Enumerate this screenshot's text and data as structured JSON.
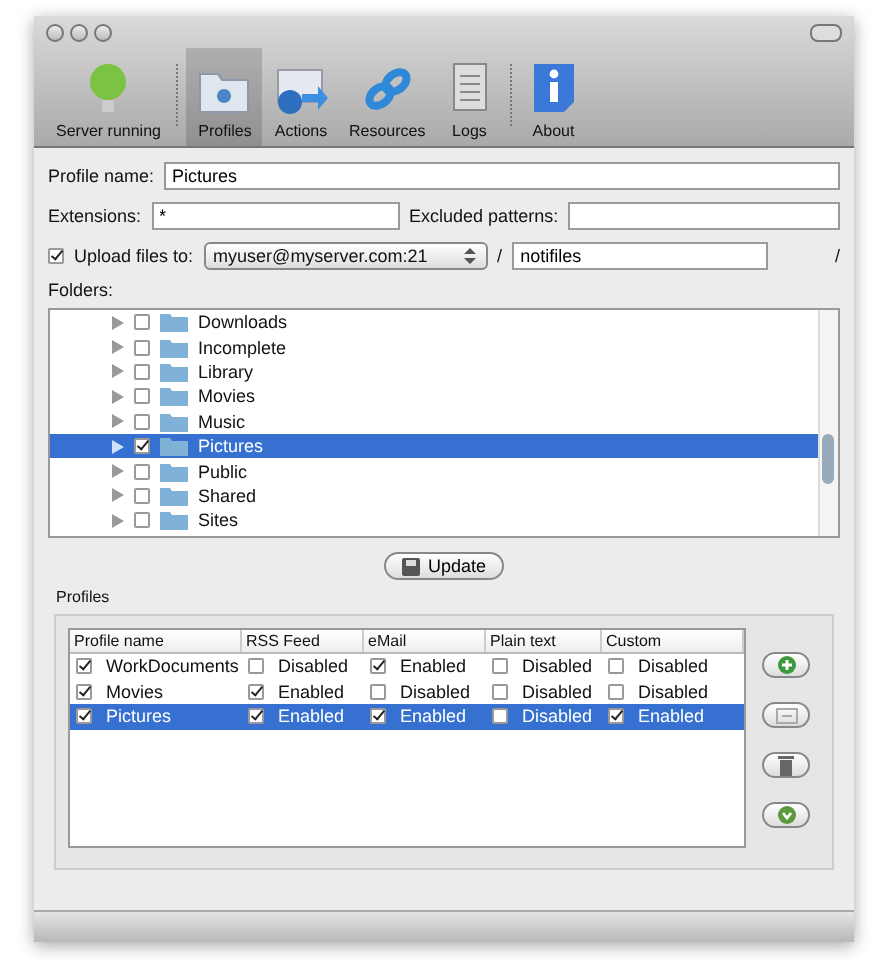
{
  "toolbar": [
    {
      "label": "Server running",
      "kind": "bulb",
      "selected": false
    },
    {
      "label": "Profiles",
      "kind": "folder",
      "selected": true
    },
    {
      "label": "Actions",
      "kind": "mail",
      "selected": false
    },
    {
      "label": "Resources",
      "kind": "link",
      "selected": false
    },
    {
      "label": "Logs",
      "kind": "doc",
      "selected": false
    },
    {
      "label": "About",
      "kind": "info",
      "selected": false
    }
  ],
  "profile_name": {
    "label": "Profile name:",
    "value": "Pictures"
  },
  "extensions": {
    "label": "Extensions:",
    "value": "*"
  },
  "excluded": {
    "label": "Excluded patterns:"
  },
  "upload": {
    "label": "Upload files to:",
    "checked": true,
    "server": "myuser@myserver.com:21",
    "separator": "/",
    "path": "notifiles",
    "trailing": "/"
  },
  "folders": {
    "label": "Folders:",
    "items": [
      {
        "name": "Downloads",
        "checked": false,
        "selected": false
      },
      {
        "name": "Incomplete",
        "checked": false,
        "selected": false
      },
      {
        "name": "Library",
        "checked": false,
        "selected": false
      },
      {
        "name": "Movies",
        "checked": false,
        "selected": false
      },
      {
        "name": "Music",
        "checked": false,
        "selected": false
      },
      {
        "name": "Pictures",
        "checked": true,
        "selected": true
      },
      {
        "name": "Public",
        "checked": false,
        "selected": false
      },
      {
        "name": "Shared",
        "checked": false,
        "selected": false
      },
      {
        "name": "Sites",
        "checked": false,
        "selected": false
      }
    ]
  },
  "update_button": "Update",
  "profiles": {
    "label": "Profiles",
    "columns": [
      "Profile name",
      "RSS Feed",
      "eMail",
      "Plain text",
      "Custom"
    ],
    "rows": [
      {
        "selected": false,
        "cells": [
          {
            "checked": true,
            "text": "WorkDocuments"
          },
          {
            "checked": false,
            "text": "Disabled"
          },
          {
            "checked": true,
            "text": "Enabled"
          },
          {
            "checked": false,
            "text": "Disabled"
          },
          {
            "checked": false,
            "text": "Disabled"
          }
        ]
      },
      {
        "selected": false,
        "cells": [
          {
            "checked": true,
            "text": "Movies"
          },
          {
            "checked": true,
            "text": "Enabled"
          },
          {
            "checked": false,
            "text": "Disabled"
          },
          {
            "checked": false,
            "text": "Disabled"
          },
          {
            "checked": false,
            "text": "Disabled"
          }
        ]
      },
      {
        "selected": true,
        "cells": [
          {
            "checked": true,
            "text": "Pictures"
          },
          {
            "checked": true,
            "text": "Enabled"
          },
          {
            "checked": true,
            "text": "Enabled"
          },
          {
            "checked": false,
            "text": "Disabled"
          },
          {
            "checked": true,
            "text": "Enabled"
          }
        ]
      }
    ]
  }
}
